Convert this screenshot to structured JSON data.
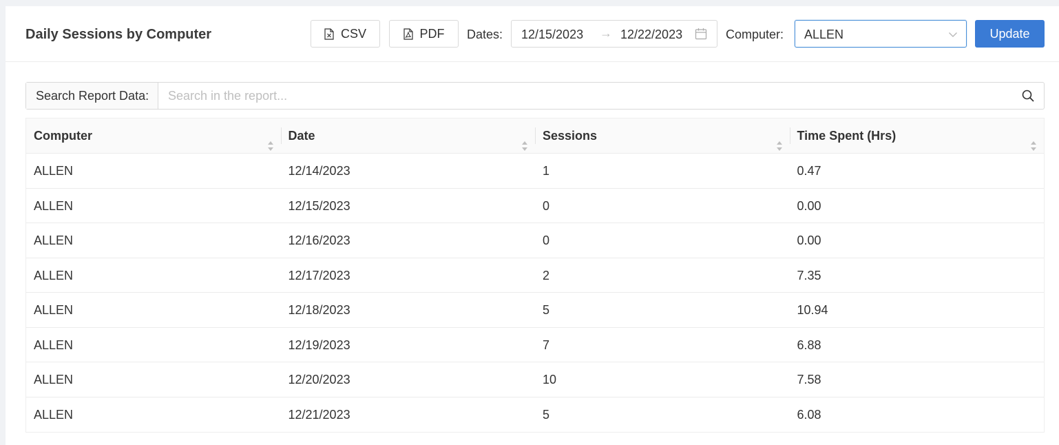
{
  "header": {
    "title": "Daily Sessions by Computer",
    "csv_label": "CSV",
    "pdf_label": "PDF",
    "dates_label": "Dates:",
    "date_start": "12/15/2023",
    "date_end": "12/22/2023",
    "computer_label": "Computer:",
    "computer_value": "ALLEN",
    "update_label": "Update"
  },
  "search": {
    "label": "Search Report Data:",
    "placeholder": "Search in the report..."
  },
  "table": {
    "columns": [
      "Computer",
      "Date",
      "Sessions",
      "Time Spent (Hrs)"
    ],
    "rows": [
      [
        "ALLEN",
        "12/14/2023",
        "1",
        "0.47"
      ],
      [
        "ALLEN",
        "12/15/2023",
        "0",
        "0.00"
      ],
      [
        "ALLEN",
        "12/16/2023",
        "0",
        "0.00"
      ],
      [
        "ALLEN",
        "12/17/2023",
        "2",
        "7.35"
      ],
      [
        "ALLEN",
        "12/18/2023",
        "5",
        "10.94"
      ],
      [
        "ALLEN",
        "12/19/2023",
        "7",
        "6.88"
      ],
      [
        "ALLEN",
        "12/20/2023",
        "10",
        "7.58"
      ],
      [
        "ALLEN",
        "12/21/2023",
        "5",
        "6.08"
      ]
    ]
  },
  "icons": {
    "csv": "file-excel-icon",
    "pdf": "file-pdf-icon",
    "calendar": "calendar-icon",
    "chevron": "chevron-down-icon",
    "search": "search-icon",
    "sort": "sort-icon"
  },
  "colors": {
    "accent": "#3a7bd5",
    "focus_border": "#4a90d9"
  }
}
